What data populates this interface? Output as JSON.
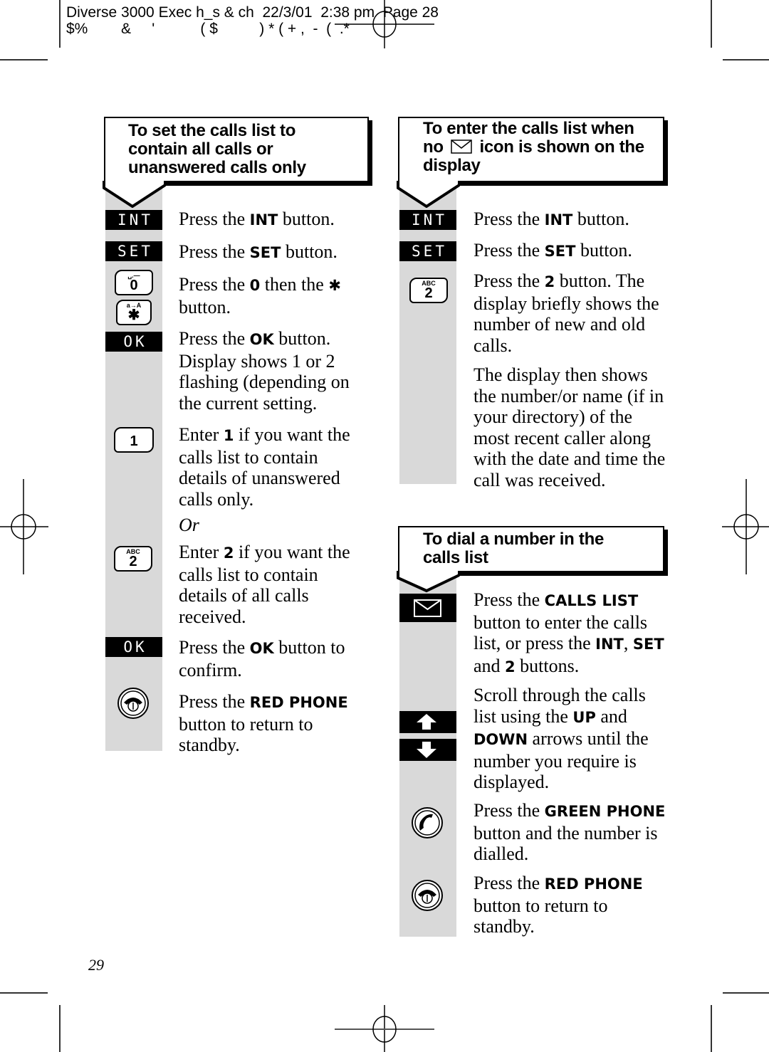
{
  "print_header": {
    "line1": "Diverse 3000 Exec h_s & ch  22/3/01  2:38 pm  Page 28",
    "line2": "$%        &     '           ( $          ) * ( + ,  -  (  .*"
  },
  "left_section": {
    "title_lines": [
      "To set the calls list to",
      "contain all calls or",
      "unanswered calls only"
    ],
    "steps": [
      {
        "key": {
          "type": "black",
          "label": "INT",
          "icon": "int-button"
        },
        "text_parts": [
          {
            "t": "Press the "
          },
          {
            "b": "INT"
          },
          {
            "t": " button."
          }
        ]
      },
      {
        "key": {
          "type": "black",
          "label": "SET",
          "icon": "set-button"
        },
        "text_parts": [
          {
            "t": "Press the "
          },
          {
            "b": "SET"
          },
          {
            "t": " button."
          }
        ]
      },
      {
        "key": {
          "type": "keypad",
          "small": "␣.—",
          "big": "0",
          "icon": "zero-key"
        },
        "key2": {
          "type": "keypad",
          "small": "a→A",
          "big": "✱",
          "icon": "star-key"
        },
        "text_parts": [
          {
            "t": "Press the "
          },
          {
            "b": "0"
          },
          {
            "t": " then the "
          },
          {
            "b": "✱"
          },
          {
            "t": " button."
          }
        ]
      },
      {
        "key": {
          "type": "black",
          "label": "OK",
          "icon": "ok-button"
        },
        "text_parts": [
          {
            "t": "Press the "
          },
          {
            "b": "OK"
          },
          {
            "t": " button. Display shows 1 or 2 flashing (depending on the current setting."
          }
        ]
      },
      {
        "key": {
          "type": "keypad",
          "small": "",
          "big": "1",
          "icon": "one-key"
        },
        "text_parts": [
          {
            "t": "Enter "
          },
          {
            "b": "1"
          },
          {
            "t": " if you want the calls list to contain details of unanswered calls only."
          }
        ]
      },
      {
        "key": null,
        "text_parts": [
          {
            "i": "Or"
          }
        ]
      },
      {
        "key": {
          "type": "keypad",
          "small": "ABC",
          "big": "2",
          "icon": "two-key"
        },
        "text_parts": [
          {
            "t": "Enter "
          },
          {
            "b": "2"
          },
          {
            "t": " if you want the calls list to contain details of all calls received."
          }
        ]
      },
      {
        "key": {
          "type": "black",
          "label": "OK",
          "icon": "ok-button"
        },
        "text_parts": [
          {
            "t": "Press the "
          },
          {
            "b": "OK"
          },
          {
            "t": " button to confirm."
          }
        ]
      },
      {
        "key": {
          "type": "phone",
          "icon": "red-phone-icon"
        },
        "text_parts": [
          {
            "t": "Press the "
          },
          {
            "b": "RED PHONE"
          },
          {
            "t": " button to return to standby."
          }
        ]
      }
    ]
  },
  "right_top_section": {
    "title_lines": [
      "To enter the calls list when",
      "no [envelope] icon is shown on the",
      "display"
    ],
    "title_parts": {
      "before": "no ",
      "icon": "envelope-icon",
      "after": " icon is shown on the"
    },
    "steps": [
      {
        "key": {
          "type": "black",
          "label": "INT"
        },
        "text_parts": [
          {
            "t": "Press the "
          },
          {
            "b": "INT"
          },
          {
            "t": " button."
          }
        ]
      },
      {
        "key": {
          "type": "black",
          "label": "SET"
        },
        "text_parts": [
          {
            "t": "Press the "
          },
          {
            "b": "SET"
          },
          {
            "t": " button."
          }
        ]
      },
      {
        "key": {
          "type": "keypad",
          "small": "ABC",
          "big": "2"
        },
        "text_parts": [
          {
            "t": "Press the "
          },
          {
            "b": "2"
          },
          {
            "t": " button. The display briefly shows the number of new and old calls."
          }
        ]
      },
      {
        "key": null,
        "text_parts": [
          {
            "t": "The display then shows the number/or name (if in your directory) of the most recent caller along with the date and time the call was received."
          }
        ]
      }
    ]
  },
  "right_bottom_section": {
    "title_lines": [
      "To dial a number in the",
      "calls list"
    ],
    "steps": [
      {
        "key": {
          "type": "envelope"
        },
        "text_parts": [
          {
            "t": "Press the "
          },
          {
            "b": "CALLS LIST"
          },
          {
            "t": " button to enter the calls list, or press the "
          },
          {
            "b": "INT"
          },
          {
            "t": ", "
          },
          {
            "b": "SET"
          },
          {
            "t": " and "
          },
          {
            "b": "2"
          },
          {
            "t": " buttons."
          }
        ]
      },
      {
        "key": {
          "type": "arrows"
        },
        "text_parts": [
          {
            "t": "Scroll through the calls list using the "
          },
          {
            "b": "UP"
          },
          {
            "t": " and "
          },
          {
            "b": "DOWN"
          },
          {
            "t": " arrows until the number you require is displayed."
          }
        ]
      },
      {
        "key": {
          "type": "green-phone"
        },
        "text_parts": [
          {
            "t": "Press the "
          },
          {
            "b": "GREEN PHONE"
          },
          {
            "t": " button and the number is dialled."
          }
        ]
      },
      {
        "key": {
          "type": "red-phone"
        },
        "text_parts": [
          {
            "t": "Press the "
          },
          {
            "b": "RED PHONE"
          },
          {
            "t": " button to return to standby."
          }
        ]
      }
    ]
  },
  "page_number": "29",
  "colors": {
    "sidebar_gray": "#d9d9d9",
    "ink": "#000000",
    "paper": "#ffffff"
  }
}
